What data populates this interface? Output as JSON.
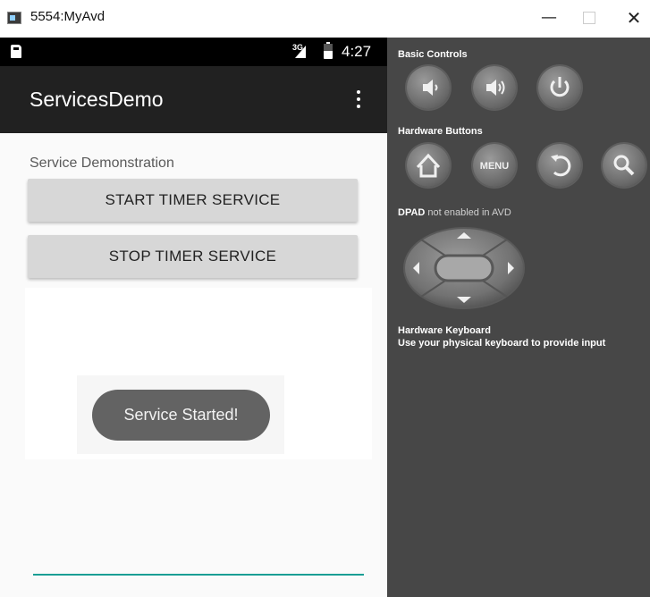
{
  "window": {
    "title": "5554:MyAvd",
    "minimize_glyph": "—",
    "close_glyph": "✕"
  },
  "status_bar": {
    "network": "3G",
    "time": "4:27"
  },
  "app_bar": {
    "title": "ServicesDemo"
  },
  "main": {
    "section_label": "Service Demonstration",
    "start_button": "START TIMER SERVICE",
    "stop_button": "STOP TIMER SERVICE",
    "toast": "Service Started!"
  },
  "controls": {
    "basic_controls_heading": "Basic Controls",
    "hardware_buttons_heading": "Hardware Buttons",
    "menu_label": "MENU",
    "dpad_heading": "DPAD",
    "dpad_note": "not enabled in AVD",
    "keyboard_heading": "Hardware Keyboard",
    "keyboard_note": "Use your physical keyboard to provide input"
  },
  "colors": {
    "app_bar": "#212121",
    "status_bar": "#000000",
    "button": "#d7d7d7",
    "toast": "#636363",
    "accent_line": "#1a9e94",
    "controls_panel": "#474747"
  }
}
